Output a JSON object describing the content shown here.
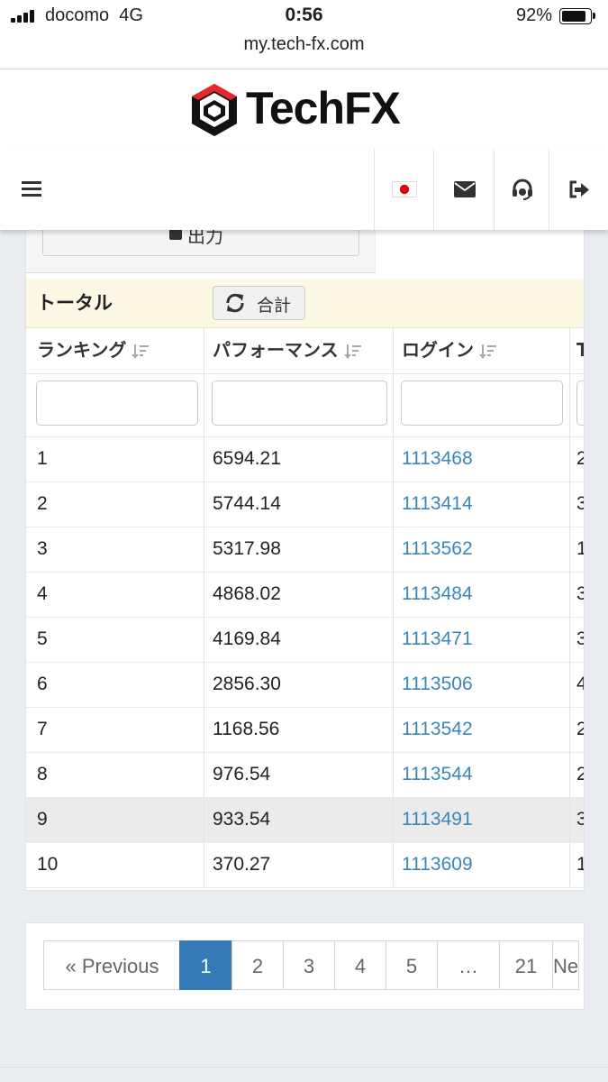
{
  "status_bar": {
    "carrier": "docomo",
    "network": "4G",
    "time": "0:56",
    "battery_percent": "92%",
    "battery_level": 0.92
  },
  "browser": {
    "url": "my.tech-fx.com"
  },
  "brand": {
    "name": "TechFX",
    "accent_color": "#e8262b"
  },
  "nav": {
    "icons": [
      "hamburger-menu-icon",
      "japan-flag-icon",
      "mail-icon",
      "support-headset-icon",
      "logout-icon"
    ]
  },
  "export": {
    "label": "出力"
  },
  "table": {
    "total_label": "トータル",
    "sum_button_label": "合計",
    "columns": [
      "ランキング",
      "パフォーマンス",
      "ログイン",
      "T"
    ],
    "rows": [
      {
        "rank": "1",
        "performance": "6594.21",
        "login": "1113468",
        "next": "2"
      },
      {
        "rank": "2",
        "performance": "5744.14",
        "login": "1113414",
        "next": "3"
      },
      {
        "rank": "3",
        "performance": "5317.98",
        "login": "1113562",
        "next": "1"
      },
      {
        "rank": "4",
        "performance": "4868.02",
        "login": "1113484",
        "next": "3"
      },
      {
        "rank": "5",
        "performance": "4169.84",
        "login": "1113471",
        "next": "3"
      },
      {
        "rank": "6",
        "performance": "2856.30",
        "login": "1113506",
        "next": "4"
      },
      {
        "rank": "7",
        "performance": "1168.56",
        "login": "1113542",
        "next": "2"
      },
      {
        "rank": "8",
        "performance": "976.54",
        "login": "1113544",
        "next": "2"
      },
      {
        "rank": "9",
        "performance": "933.54",
        "login": "1113491",
        "next": "3"
      },
      {
        "rank": "10",
        "performance": "370.27",
        "login": "1113609",
        "next": "1"
      }
    ],
    "highlighted_row": "9"
  },
  "pagination": {
    "previous_label": "« Previous",
    "pages": [
      "1",
      "2",
      "3",
      "4",
      "5",
      "…",
      "21"
    ],
    "next_label": "Ne",
    "active_page": "1"
  }
}
